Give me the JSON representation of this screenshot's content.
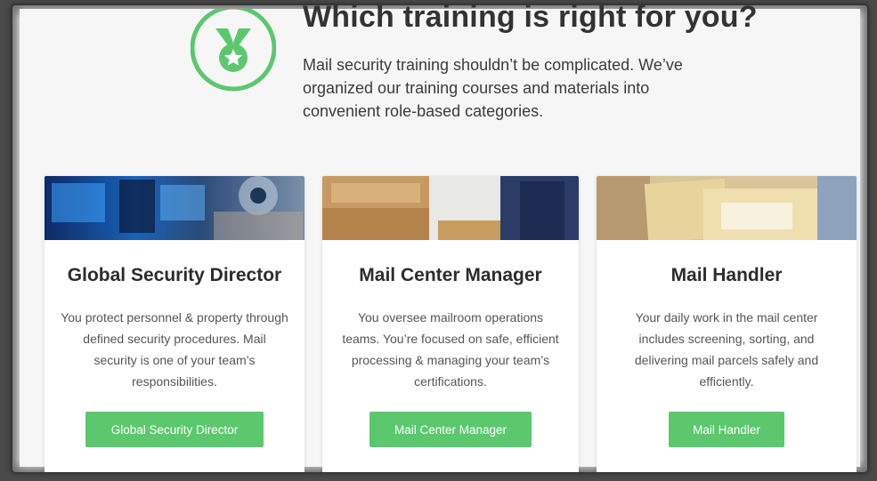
{
  "header": {
    "title": "Which training is right for you?",
    "intro": "Mail security training shouldn’t be complicated. We’ve organized our training courses and materials into convenient role-based categories.",
    "icon": "medal-icon",
    "accent": "#5bc86e"
  },
  "cards": [
    {
      "title": "Global Security Director",
      "description": "You protect personnel & property through defined security procedures. Mail security is one of your team’s responsibilities.",
      "button": "Global Security Director"
    },
    {
      "title": "Mail Center Manager",
      "description": "You oversee mailroom operations teams. You’re focused on safe, efficient processing & managing your team’s certifications.",
      "button": "Mail Center Manager"
    },
    {
      "title": "Mail Handler",
      "description": "Your daily work in the mail center includes screening, sorting, and delivering mail parcels safely and efficiently.",
      "button": "Mail Handler"
    }
  ]
}
